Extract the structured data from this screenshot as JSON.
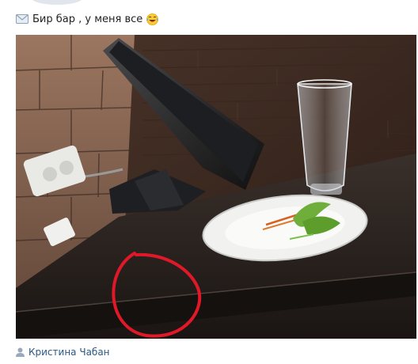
{
  "message": {
    "text": "Бир бар , у меня все",
    "envelope_icon": "envelope-icon",
    "emoji_icon": "laughing-emoji-icon"
  },
  "photo": {
    "description_icons": [
      "monitor-icon",
      "power-outlet-icon",
      "beer-glass-icon",
      "plate-icon",
      "red-circle-annotation"
    ]
  },
  "author": {
    "icon": "person-icon",
    "name": "Кристина Чабан"
  },
  "colors": {
    "link": "#2a5885",
    "circle": "#e01828",
    "bar": "#2b231f",
    "wood": "#4a3428",
    "brick": "#8a6550"
  }
}
